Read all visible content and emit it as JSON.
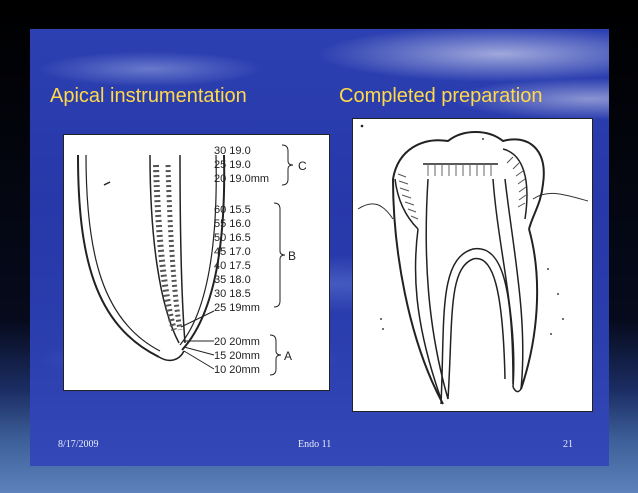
{
  "titles": {
    "left": "Apical instrumentation",
    "right": "Completed preparation"
  },
  "footer": {
    "date": "8/17/2009",
    "center": "Endo 11",
    "page": "21"
  },
  "diagram": {
    "group_c": [
      "30 19.0",
      "25 19.0",
      "20 19.0mm"
    ],
    "group_b": [
      "60 15.5",
      "55 16.0",
      "50 16.5",
      "45 17.0",
      "40 17.5",
      "35 18.0",
      "30 18.5",
      "25 19mm"
    ],
    "group_a": [
      "20 20mm",
      "15 20mm",
      "10 20mm"
    ],
    "group_labels": {
      "c": "C",
      "b": "B",
      "a": "A"
    }
  }
}
